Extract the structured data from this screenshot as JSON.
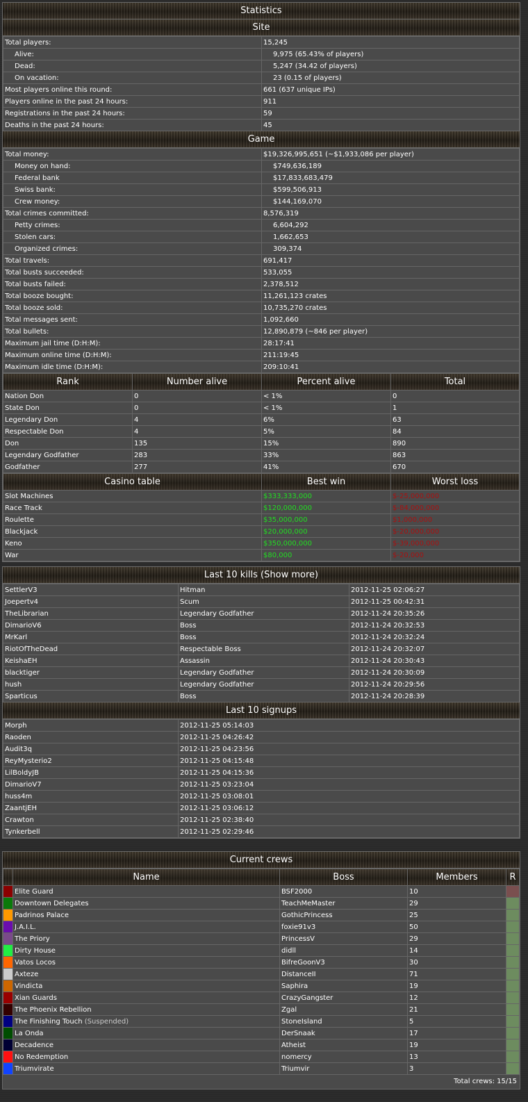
{
  "stats": {
    "title": "Statistics",
    "site_title": "Site",
    "site": [
      {
        "label": "Total players:",
        "value": "15,245",
        "indent": false
      },
      {
        "label": "Alive:",
        "value": "9,975 (65.43% of players)",
        "indent": true
      },
      {
        "label": "Dead:",
        "value": "5,247 (34.42 of players)",
        "indent": true
      },
      {
        "label": "On vacation:",
        "value": "23 (0.15 of players)",
        "indent": true
      },
      {
        "label": "Most players online this round:",
        "value": "661 (637 unique IPs)",
        "indent": false
      },
      {
        "label": "Players online in the past 24 hours:",
        "value": "911",
        "indent": false
      },
      {
        "label": "Registrations in the past 24 hours:",
        "value": "59",
        "indent": false
      },
      {
        "label": "Deaths in the past 24 hours:",
        "value": "45",
        "indent": false
      }
    ],
    "game_title": "Game",
    "game": [
      {
        "label": "Total money:",
        "value": "$19,326,995,651 (~$1,933,086 per player)",
        "indent": false
      },
      {
        "label": "Money on hand:",
        "value": "$749,636,189",
        "indent": true
      },
      {
        "label": "Federal bank",
        "value": "$17,833,683,479",
        "indent": true
      },
      {
        "label": "Swiss bank:",
        "value": "$599,506,913",
        "indent": true
      },
      {
        "label": "Crew money:",
        "value": "$144,169,070",
        "indent": true
      },
      {
        "label": "Total crimes committed:",
        "value": "8,576,319",
        "indent": false
      },
      {
        "label": "Petty crimes:",
        "value": "6,604,292",
        "indent": true
      },
      {
        "label": "Stolen cars:",
        "value": "1,662,653",
        "indent": true
      },
      {
        "label": "Organized crimes:",
        "value": "309,374",
        "indent": true
      },
      {
        "label": "Total travels:",
        "value": "691,417",
        "indent": false
      },
      {
        "label": "Total busts succeeded:",
        "value": "533,055",
        "indent": false
      },
      {
        "label": "Total busts failed:",
        "value": "2,378,512",
        "indent": false
      },
      {
        "label": "Total booze bought:",
        "value": "11,261,123 crates",
        "indent": false
      },
      {
        "label": "Total booze sold:",
        "value": "10,735,270 crates",
        "indent": false
      },
      {
        "label": "Total messages sent:",
        "value": "1,092,660",
        "indent": false
      },
      {
        "label": "Total bullets:",
        "value": "12,890,879 (~846 per player)",
        "indent": false
      },
      {
        "label": "Maximum jail time (D:H:M):",
        "value": "28:17:41",
        "indent": false
      },
      {
        "label": "Maximum online time (D:H:M):",
        "value": "211:19:45",
        "indent": false
      },
      {
        "label": "Maximum idle time (D:H:M):",
        "value": "209:10:41",
        "indent": false
      }
    ],
    "rank_headers": [
      "Rank",
      "Number alive",
      "Percent alive",
      "Total"
    ],
    "ranks": [
      [
        "Nation Don",
        "0",
        "< 1%",
        "0"
      ],
      [
        "State Don",
        "0",
        "< 1%",
        "1"
      ],
      [
        "Legendary Don",
        "4",
        "6%",
        "63"
      ],
      [
        "Respectable Don",
        "4",
        "5%",
        "84"
      ],
      [
        "Don",
        "135",
        "15%",
        "890"
      ],
      [
        "Legendary Godfather",
        "283",
        "33%",
        "863"
      ],
      [
        "Godfather",
        "277",
        "41%",
        "670"
      ]
    ],
    "casino_headers": [
      "Casino table",
      "Best win",
      "Worst loss"
    ],
    "casino": [
      [
        "Slot Machines",
        "$333,333,000",
        "$-25,000,000"
      ],
      [
        "Race Track",
        "$120,000,000",
        "$-84,000,000"
      ],
      [
        "Roulette",
        "$35,000,000",
        "$1,000,000"
      ],
      [
        "Blackjack",
        "$20,000,000",
        "$-20,000,000"
      ],
      [
        "Keno",
        "$350,000,000",
        "$-39,000,000"
      ],
      [
        "War",
        "$80,000",
        "$-20,000"
      ]
    ]
  },
  "kills": {
    "title": "Last 10 kills (Show more)",
    "rows": [
      [
        "SettlerV3",
        "Hitman",
        "2012-11-25 02:06:27"
      ],
      [
        "Joepertv4",
        "Scum",
        "2012-11-25 00:42:31"
      ],
      [
        "TheLibrarian",
        "Legendary Godfather",
        "2012-11-24 20:35:26"
      ],
      [
        "DimarioV6",
        "Boss",
        "2012-11-24 20:32:53"
      ],
      [
        "MrKarl",
        "Boss",
        "2012-11-24 20:32:24"
      ],
      [
        "RiotOfTheDead",
        "Respectable Boss",
        "2012-11-24 20:32:07"
      ],
      [
        "KeishaEH",
        "Assassin",
        "2012-11-24 20:30:43"
      ],
      [
        "blacktiger",
        "Legendary Godfather",
        "2012-11-24 20:30:09"
      ],
      [
        "hush",
        "Legendary Godfather",
        "2012-11-24 20:29:56"
      ],
      [
        "Sparticus",
        "Boss",
        "2012-11-24 20:28:39"
      ]
    ]
  },
  "signups": {
    "title": "Last 10 signups",
    "rows": [
      [
        "Morph",
        "2012-11-25 05:14:03"
      ],
      [
        "Raoden",
        "2012-11-25 04:26:42"
      ],
      [
        "Audit3q",
        "2012-11-25 04:23:56"
      ],
      [
        "ReyMysterio2",
        "2012-11-25 04:15:48"
      ],
      [
        "LilBoldyJB",
        "2012-11-25 04:15:36"
      ],
      [
        "DimarioV7",
        "2012-11-25 03:23:04"
      ],
      [
        "huss4m",
        "2012-11-25 03:08:01"
      ],
      [
        "ZaantjEH",
        "2012-11-25 03:06:12"
      ],
      [
        "Crawton",
        "2012-11-25 02:38:40"
      ],
      [
        "Tynkerbell",
        "2012-11-25 02:29:46"
      ]
    ]
  },
  "crews": {
    "title": "Current crews",
    "headers": [
      "Name",
      "Boss",
      "Members",
      "R"
    ],
    "rows": [
      {
        "color": "#8b0000",
        "name": "Elite Guard",
        "suspended": "",
        "boss": "BSF2000",
        "members": "10",
        "r": "red"
      },
      {
        "color": "#0a7a0a",
        "name": "Downtown Delegates",
        "suspended": "",
        "boss": "TeachMeMaster",
        "members": "29",
        "r": "green"
      },
      {
        "color": "#ff9900",
        "name": "Padrinos Palace",
        "suspended": "",
        "boss": "GothicPrincess",
        "members": "25",
        "r": "green"
      },
      {
        "color": "#6a0dad",
        "name": "J.A.I.L.",
        "suspended": "",
        "boss": "foxie91v3",
        "members": "50",
        "r": "green"
      },
      {
        "color": "#7a4a8a",
        "name": "The Priory",
        "suspended": "",
        "boss": "PrincessV",
        "members": "29",
        "r": "green"
      },
      {
        "color": "#22ee44",
        "name": "Dirty House",
        "suspended": "",
        "boss": "didll",
        "members": "14",
        "r": "green"
      },
      {
        "color": "#ff6600",
        "name": "Vatos Locos",
        "suspended": "",
        "boss": "BifreGoonV3",
        "members": "30",
        "r": "green"
      },
      {
        "color": "#cccccc",
        "name": "Axteze",
        "suspended": "",
        "boss": "DistanceII",
        "members": "71",
        "r": "green"
      },
      {
        "color": "#cc6600",
        "name": "Vindicta",
        "suspended": "",
        "boss": "Saphira",
        "members": "19",
        "r": "green"
      },
      {
        "color": "#990000",
        "name": "Xian Guards",
        "suspended": "",
        "boss": "CrazyGangster",
        "members": "12",
        "r": "green"
      },
      {
        "color": "#330000",
        "name": "The Phoenix Rebellion",
        "suspended": "",
        "boss": "Zgal",
        "members": "21",
        "r": "green"
      },
      {
        "color": "#000080",
        "name": "The Finishing Touch",
        "suspended": "(Suspended)",
        "boss": "StoneIsland",
        "members": "5",
        "r": "green"
      },
      {
        "color": "#004d00",
        "name": "La Onda",
        "suspended": "",
        "boss": "DerSnaak",
        "members": "17",
        "r": "green"
      },
      {
        "color": "#000033",
        "name": "Decadence",
        "suspended": "",
        "boss": "Atheist",
        "members": "19",
        "r": "green"
      },
      {
        "color": "#ff1111",
        "name": "No Redemption",
        "suspended": "",
        "boss": "nomercy",
        "members": "13",
        "r": "green"
      },
      {
        "color": "#1144ff",
        "name": "Triumvirate",
        "suspended": "",
        "boss": "Triumvir",
        "members": "3",
        "r": "green"
      }
    ],
    "footer": "Total crews: 15/15"
  }
}
